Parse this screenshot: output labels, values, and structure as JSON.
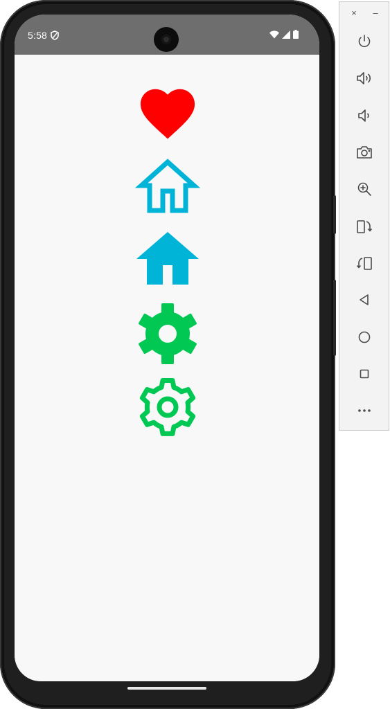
{
  "status_bar": {
    "time": "5:58",
    "icons": [
      "shield-icon",
      "wifi-icon",
      "cell-signal-icon",
      "battery-icon"
    ]
  },
  "app": {
    "icons": [
      {
        "name": "heart-filled-icon",
        "color": "#ff0000"
      },
      {
        "name": "home-outlined-icon",
        "color": "#00b4d8"
      },
      {
        "name": "home-filled-icon",
        "color": "#00b4d8"
      },
      {
        "name": "settings-filled-icon",
        "color": "#00c853"
      },
      {
        "name": "settings-outlined-icon",
        "color": "#00c853"
      }
    ]
  },
  "emulator_toolbar": {
    "close_label": "×",
    "minimize_label": "–",
    "buttons": [
      "power-icon",
      "volume-up-icon",
      "volume-down-icon",
      "camera-icon",
      "zoom-icon",
      "rotate-left-icon",
      "rotate-right-icon",
      "back-icon",
      "home-icon",
      "overview-icon",
      "more-icon"
    ]
  },
  "colors": {
    "heart": "#ff0000",
    "home": "#00b4d8",
    "settings": "#00c853",
    "screen_background": "#f8f8f8",
    "status_bar": "#6e6e6e",
    "toolbar_icon": "#4a4a4a"
  }
}
